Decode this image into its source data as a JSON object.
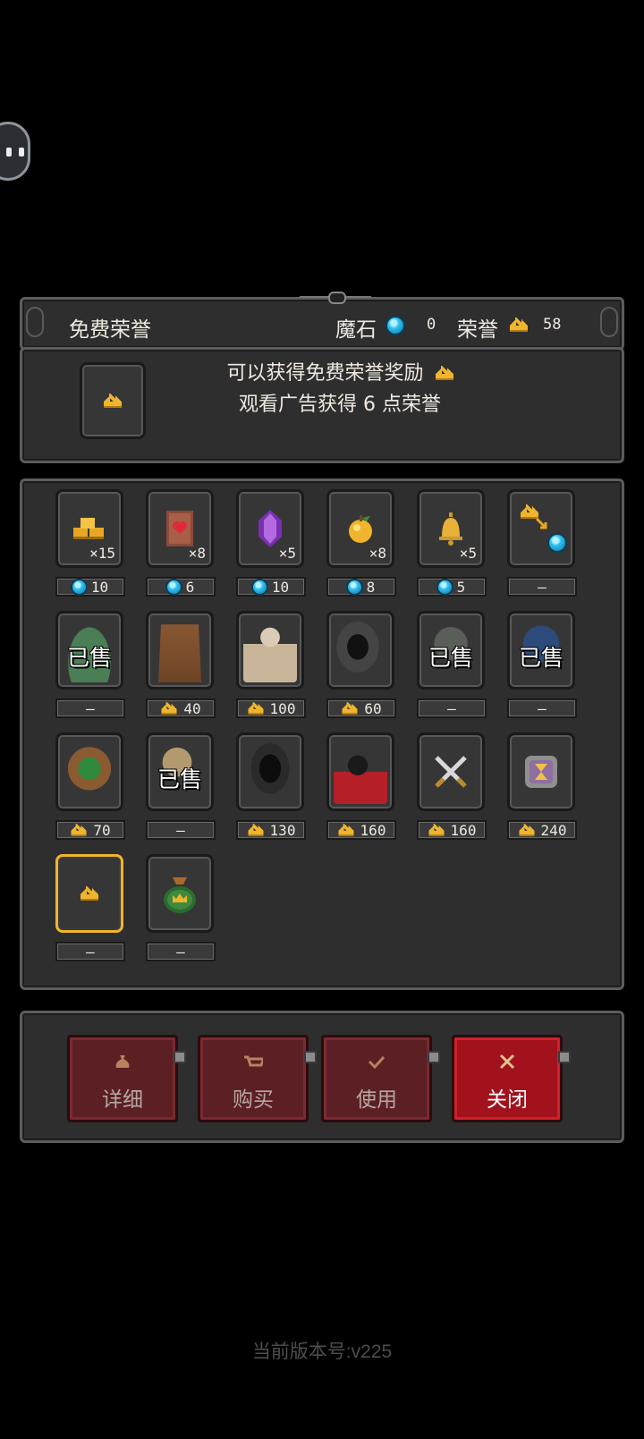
{
  "header": {
    "title": "免费荣誉",
    "magic_stone_label": "魔石",
    "magic_stone_value": "0",
    "honor_label": "荣誉",
    "honor_value": "58"
  },
  "info": {
    "line1": "可以获得免费荣誉奖励",
    "line2": "观看广告获得 6 点荣誉"
  },
  "shop": {
    "items": [
      {
        "icon": "gold-stack-icon",
        "qty": "×15",
        "currency": "gem",
        "price": "10"
      },
      {
        "icon": "heart-scroll-icon",
        "qty": "×8",
        "currency": "gem",
        "price": "6"
      },
      {
        "icon": "purple-crystal-icon",
        "qty": "×5",
        "currency": "gem",
        "price": "10"
      },
      {
        "icon": "golden-apple-icon",
        "qty": "×8",
        "currency": "gem",
        "price": "8"
      },
      {
        "icon": "bell-icon",
        "qty": "×5",
        "currency": "gem",
        "price": "5"
      },
      {
        "icon": "crown-to-gem-exchange-icon",
        "qty": "",
        "currency": "none",
        "price": "—"
      },
      {
        "icon": "green-slime-character",
        "sold": "已售",
        "currency": "none",
        "price": "—"
      },
      {
        "icon": "tree-monster-character",
        "currency": "crown",
        "price": "40"
      },
      {
        "icon": "armored-knight-character",
        "currency": "crown",
        "price": "100"
      },
      {
        "icon": "hooded-wizard-character",
        "currency": "crown",
        "price": "60"
      },
      {
        "icon": "zombie-character",
        "sold": "已售",
        "currency": "none",
        "price": "—"
      },
      {
        "icon": "blue-haired-girl-character",
        "sold": "已售",
        "currency": "none",
        "price": "—"
      },
      {
        "icon": "forest-treant-character",
        "currency": "crown",
        "price": "70"
      },
      {
        "icon": "blonde-girl-character",
        "sold": "已售",
        "currency": "none",
        "price": "—"
      },
      {
        "icon": "shadow-reaper-character",
        "currency": "crown",
        "price": "130"
      },
      {
        "icon": "pirate-mage-character",
        "currency": "crown",
        "price": "160"
      },
      {
        "icon": "crossed-swords-icon",
        "currency": "crown",
        "price": "160"
      },
      {
        "icon": "hourglass-icon",
        "currency": "crown",
        "price": "240"
      },
      {
        "icon": "free-honor-crown-icon",
        "currency": "none",
        "price": "—",
        "selected": true
      },
      {
        "icon": "honor-bag-icon",
        "currency": "none",
        "price": "—"
      }
    ]
  },
  "buttons": {
    "details": "详细",
    "buy": "购买",
    "use": "使用",
    "close": "关闭"
  },
  "version_text": "当前版本号:v225",
  "colors": {
    "panel": "#2e2e2e",
    "crown": "#f0b52c",
    "gem": "#33c3f2",
    "button": "#5b1f24",
    "button_primary": "#a1121c"
  }
}
